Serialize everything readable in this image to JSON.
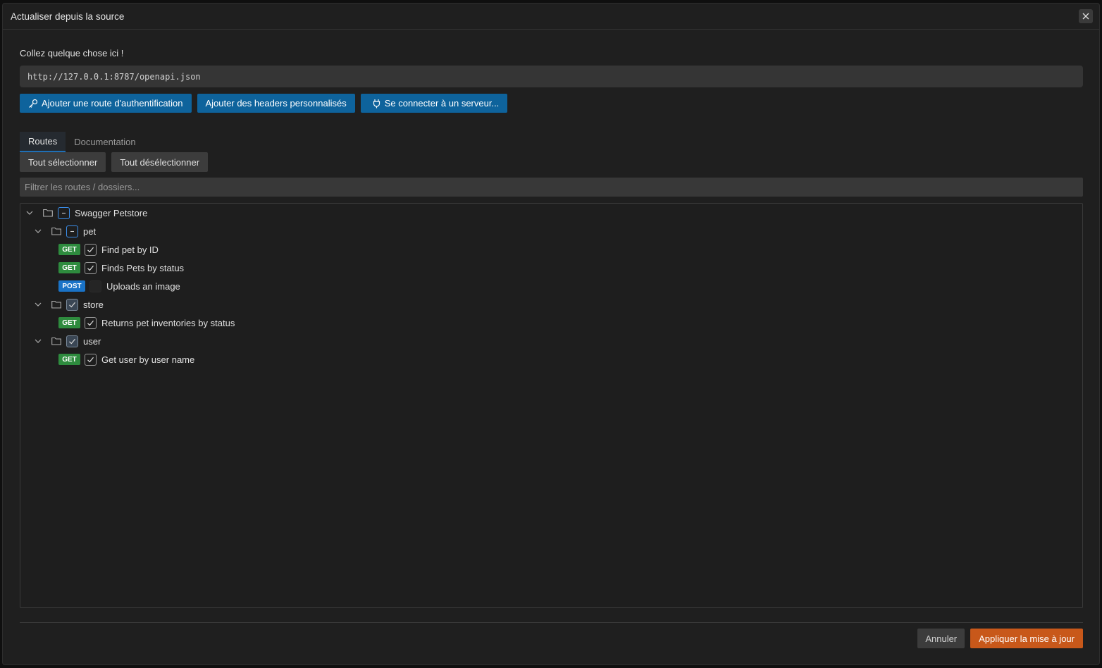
{
  "dialog": {
    "title": "Actualiser depuis la source"
  },
  "source": {
    "label": "Collez quelque chose ici !",
    "value": "http://127.0.0.1:8787/openapi.json"
  },
  "actions": {
    "auth_route": "Ajouter une route d'authentification",
    "custom_headers": "Ajouter des headers personnalisés",
    "connect_server": "Se connecter à un serveur..."
  },
  "tabs": {
    "routes": "Routes",
    "documentation": "Documentation"
  },
  "selection": {
    "select_all": "Tout sélectionner",
    "deselect_all": "Tout désélectionner"
  },
  "filter": {
    "placeholder": "Filtrer les routes / dossiers..."
  },
  "tree": {
    "root": {
      "label": "Swagger Petstore",
      "state": "partial"
    },
    "pet": {
      "label": "pet",
      "state": "partial",
      "routes": [
        {
          "method": "GET",
          "label": "Find pet by ID",
          "checked": true
        },
        {
          "method": "GET",
          "label": "Finds Pets by status",
          "checked": true
        },
        {
          "method": "POST",
          "label": "Uploads an image",
          "checked": false
        }
      ]
    },
    "store": {
      "label": "store",
      "state": "checked",
      "routes": [
        {
          "method": "GET",
          "label": "Returns pet inventories by status",
          "checked": true
        }
      ]
    },
    "user": {
      "label": "user",
      "state": "checked",
      "routes": [
        {
          "method": "GET",
          "label": "Get user by user name",
          "checked": true
        }
      ]
    }
  },
  "footer": {
    "cancel": "Annuler",
    "apply": "Appliquer la mise à jour"
  },
  "colors": {
    "accent_blue": "#0e639c",
    "apply_orange": "#c8581a",
    "get_green": "#2e8b3e",
    "post_blue": "#1a73c7"
  }
}
